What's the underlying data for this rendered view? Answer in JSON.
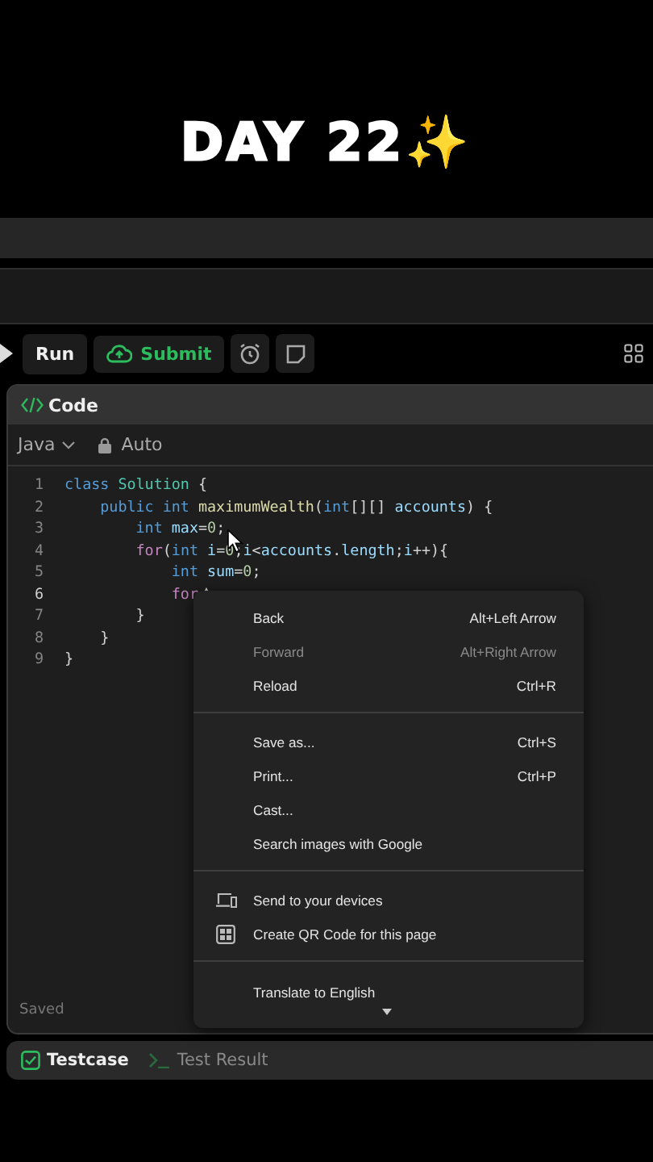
{
  "title": "DAY 22✨",
  "toolbar": {
    "run": "Run",
    "submit": "Submit"
  },
  "editor": {
    "tab": "Code",
    "language": "Java",
    "mode": "Auto",
    "status": "Saved",
    "lines": [
      {
        "number": "1",
        "current": false,
        "tokens": [
          {
            "t": "class ",
            "kind": "kw"
          },
          {
            "t": "Solution",
            "kind": "type"
          },
          {
            "t": " {",
            "kind": "p"
          }
        ]
      },
      {
        "number": "2",
        "current": false,
        "tokens": [
          {
            "t": "    public int ",
            "kind": "kw"
          },
          {
            "t": "maximumWealth",
            "kind": "fn"
          },
          {
            "t": "(",
            "kind": "p"
          },
          {
            "t": "int",
            "kind": "kw"
          },
          {
            "t": "[][] ",
            "kind": "p"
          },
          {
            "t": "accounts",
            "kind": "var"
          },
          {
            "t": ") {",
            "kind": "p"
          }
        ]
      },
      {
        "number": "3",
        "current": false,
        "tokens": [
          {
            "t": "        int ",
            "kind": "kw"
          },
          {
            "t": "max",
            "kind": "var"
          },
          {
            "t": "=",
            "kind": "p"
          },
          {
            "t": "0",
            "kind": "num"
          },
          {
            "t": ";",
            "kind": "p"
          }
        ]
      },
      {
        "number": "4",
        "current": false,
        "tokens": [
          {
            "t": "        for",
            "kind": "ctl"
          },
          {
            "t": "(",
            "kind": "p"
          },
          {
            "t": "int ",
            "kind": "kw"
          },
          {
            "t": "i",
            "kind": "var"
          },
          {
            "t": "=",
            "kind": "p"
          },
          {
            "t": "0",
            "kind": "num"
          },
          {
            "t": ";",
            "kind": "p"
          },
          {
            "t": "i",
            "kind": "var"
          },
          {
            "t": "<",
            "kind": "p"
          },
          {
            "t": "accounts",
            "kind": "var"
          },
          {
            "t": ".",
            "kind": "p"
          },
          {
            "t": "length",
            "kind": "var"
          },
          {
            "t": ";",
            "kind": "p"
          },
          {
            "t": "i",
            "kind": "var"
          },
          {
            "t": "++){",
            "kind": "p"
          }
        ]
      },
      {
        "number": "5",
        "current": false,
        "tokens": [
          {
            "t": "            int ",
            "kind": "kw"
          },
          {
            "t": "sum",
            "kind": "var"
          },
          {
            "t": "=",
            "kind": "p"
          },
          {
            "t": "0",
            "kind": "num"
          },
          {
            "t": ";",
            "kind": "p"
          }
        ]
      },
      {
        "number": "6",
        "current": true,
        "tokens": [
          {
            "t": "            for",
            "kind": "ctl"
          }
        ]
      },
      {
        "number": "7",
        "current": false,
        "tokens": [
          {
            "t": "        }",
            "kind": "p"
          }
        ]
      },
      {
        "number": "8",
        "current": false,
        "tokens": [
          {
            "t": "    }",
            "kind": "p"
          }
        ]
      },
      {
        "number": "9",
        "current": false,
        "tokens": [
          {
            "t": "}",
            "kind": "p"
          }
        ]
      }
    ]
  },
  "context_menu": [
    {
      "kind": "text",
      "label": "Back",
      "shortcut": "Alt+Left Arrow",
      "disabled": false
    },
    {
      "kind": "text",
      "label": "Forward",
      "shortcut": "Alt+Right Arrow",
      "disabled": true
    },
    {
      "kind": "text",
      "label": "Reload",
      "shortcut": "Ctrl+R",
      "disabled": false
    },
    {
      "kind": "separator"
    },
    {
      "kind": "text",
      "label": "Save as...",
      "shortcut": "Ctrl+S",
      "disabled": false
    },
    {
      "kind": "text",
      "label": "Print...",
      "shortcut": "Ctrl+P",
      "disabled": false
    },
    {
      "kind": "text",
      "label": "Cast...",
      "disabled": false
    },
    {
      "kind": "text",
      "label": "Search images with Google",
      "disabled": false
    },
    {
      "kind": "separator"
    },
    {
      "kind": "devices",
      "label": "Send to your devices",
      "disabled": false
    },
    {
      "kind": "qr",
      "label": "Create QR Code for this page",
      "disabled": false
    },
    {
      "kind": "separator"
    },
    {
      "kind": "cut",
      "label": "Translate to English"
    }
  ],
  "bottom_tabs": [
    {
      "label": "Testcase",
      "selected": true
    },
    {
      "label": "Test Result",
      "selected": false
    }
  ]
}
